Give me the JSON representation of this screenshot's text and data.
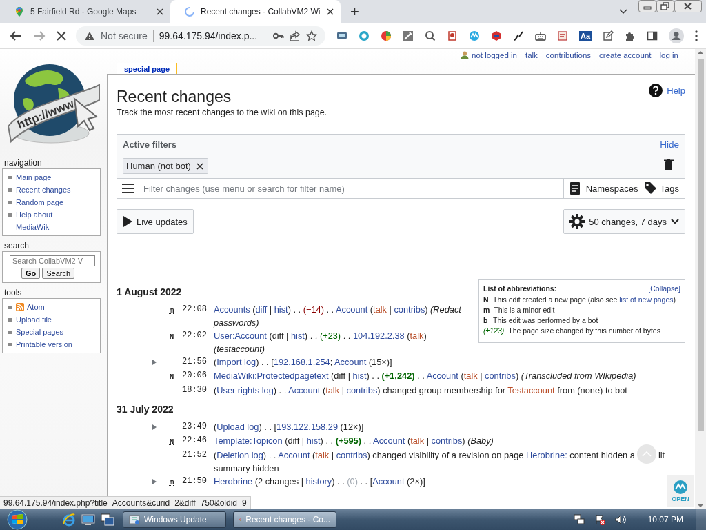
{
  "browser": {
    "tabs": [
      {
        "title": "5 Fairfield Rd - Google Maps",
        "kind": "maps",
        "selected": false
      },
      {
        "title": "Recent changes - CollabVM2 Wi",
        "kind": "loading",
        "selected": true
      }
    ],
    "new_tab": "+",
    "security": "Not secure",
    "url": "99.64.175.94/index.p...",
    "extension_label": "Aa",
    "status_url": "99.64.175.94/index.php?title=Accounts&curid=2&diff=750&oldid=9"
  },
  "personal": [
    "not logged in",
    "talk",
    "contributions",
    "create account",
    "log in"
  ],
  "logo_text": "http://www",
  "sidebar": [
    {
      "title": "navigation",
      "kind": "links",
      "items": [
        "Main page",
        "Recent changes",
        "Random page",
        "Help about MediaWiki"
      ]
    },
    {
      "title": "search",
      "kind": "search",
      "placeholder": "Search CollabVM2 V",
      "buttons": [
        "Go",
        "Search"
      ]
    },
    {
      "title": "tools",
      "kind": "links",
      "items": [
        {
          "label": "Atom",
          "kind": "feed"
        },
        {
          "label": "Upload file",
          "kind": "link"
        },
        {
          "label": "Special pages",
          "kind": "link"
        },
        {
          "label": "Printable version",
          "kind": "link"
        }
      ]
    }
  ],
  "content": {
    "tab": "special page",
    "title": "Recent changes",
    "help": "Help",
    "subtitle": "Track the most recent changes to the wiki on this page.",
    "filters": {
      "title": "Active filters",
      "hide": "Hide",
      "tags": [
        "Human (not bot)"
      ],
      "placeholder": "Filter changes (use menu or search for filter name)",
      "buttons": [
        "Namespaces",
        "Tags"
      ]
    },
    "live": "Live updates",
    "options": "50 changes, 7 days",
    "legend": {
      "title": "List of abbreviations:",
      "collapse": "[Collapse]",
      "rows": [
        {
          "key": "N",
          "kind": "flag",
          "parts": [
            {
              "kind": "text",
              "text": "This edit created a new page (also see "
            },
            {
              "kind": "link",
              "text": "list of new pages"
            },
            {
              "kind": "text",
              "text": ")"
            }
          ]
        },
        {
          "key": "m",
          "kind": "flag",
          "parts": [
            {
              "kind": "text",
              "text": "This is a minor edit"
            }
          ]
        },
        {
          "key": "b",
          "kind": "flag",
          "parts": [
            {
              "kind": "text",
              "text": "This edit was performed by a bot"
            }
          ]
        },
        {
          "key": "(±123)",
          "kind": "size",
          "parts": [
            {
              "kind": "text",
              "text": "The page size changed by this number of bytes"
            }
          ]
        }
      ]
    },
    "days": [
      {
        "date": "1 August 2022",
        "changes": [
          {
            "group": false,
            "flag": "m",
            "time": "22:08",
            "parts": [
              {
                "kind": "link",
                "text": "Accounts"
              },
              {
                "kind": "text",
                "text": " ("
              },
              {
                "kind": "link",
                "text": "diff"
              },
              {
                "kind": "text",
                "text": " | "
              },
              {
                "kind": "link",
                "text": "hist"
              },
              {
                "kind": "text",
                "text": ") . . "
              },
              {
                "kind": "neg",
                "text": "(−14)"
              },
              {
                "kind": "text",
                "text": " . . "
              },
              {
                "kind": "link",
                "text": "Account"
              },
              {
                "kind": "text",
                "text": " ("
              },
              {
                "kind": "red",
                "text": "talk"
              },
              {
                "kind": "text",
                "text": " | "
              },
              {
                "kind": "link",
                "text": "contribs"
              },
              {
                "kind": "text",
                "text": ") "
              },
              {
                "kind": "comment",
                "text": "(Redact passwords)"
              }
            ]
          },
          {
            "group": false,
            "flag": "N",
            "time": "22:02",
            "parts": [
              {
                "kind": "link",
                "text": "User:Account"
              },
              {
                "kind": "text",
                "text": " (diff | "
              },
              {
                "kind": "link",
                "text": "hist"
              },
              {
                "kind": "text",
                "text": ") . . "
              },
              {
                "kind": "pos",
                "text": "(+23)"
              },
              {
                "kind": "text",
                "text": " . . "
              },
              {
                "kind": "link",
                "text": "104.192.2.38"
              },
              {
                "kind": "text",
                "text": " ("
              },
              {
                "kind": "red",
                "text": "talk"
              },
              {
                "kind": "text",
                "text": ") "
              },
              {
                "kind": "comment",
                "text": "(testaccount)"
              }
            ]
          },
          {
            "group": true,
            "time": "21:56",
            "parts": [
              {
                "kind": "text",
                "text": "("
              },
              {
                "kind": "link",
                "text": "Import log"
              },
              {
                "kind": "text",
                "text": ") . . ["
              },
              {
                "kind": "link",
                "text": "192.168.1.254"
              },
              {
                "kind": "text",
                "text": "; "
              },
              {
                "kind": "link",
                "text": "Account"
              },
              {
                "kind": "text",
                "text": " (15×)]"
              }
            ]
          },
          {
            "group": false,
            "flag": "N",
            "time": "20:06",
            "parts": [
              {
                "kind": "link",
                "text": "MediaWiki:Protectedpagetext"
              },
              {
                "kind": "text",
                "text": " (diff | "
              },
              {
                "kind": "link",
                "text": "hist"
              },
              {
                "kind": "text",
                "text": ") . . "
              },
              {
                "kind": "posbig",
                "text": "(+1,242)"
              },
              {
                "kind": "text",
                "text": " . . "
              },
              {
                "kind": "link",
                "text": "Account"
              },
              {
                "kind": "text",
                "text": " ("
              },
              {
                "kind": "red",
                "text": "talk"
              },
              {
                "kind": "text",
                "text": " | "
              },
              {
                "kind": "link",
                "text": "contribs"
              },
              {
                "kind": "text",
                "text": ") "
              },
              {
                "kind": "comment",
                "text": "(Transcluded from WIkipedia)"
              }
            ]
          },
          {
            "group": false,
            "time": "18:30",
            "parts": [
              {
                "kind": "text",
                "text": "("
              },
              {
                "kind": "link",
                "text": "User rights log"
              },
              {
                "kind": "text",
                "text": ") . . "
              },
              {
                "kind": "link",
                "text": "Account"
              },
              {
                "kind": "text",
                "text": " ("
              },
              {
                "kind": "red",
                "text": "talk"
              },
              {
                "kind": "text",
                "text": " | "
              },
              {
                "kind": "link",
                "text": "contribs"
              },
              {
                "kind": "text",
                "text": ") changed group membership for "
              },
              {
                "kind": "red",
                "text": "Testaccount"
              },
              {
                "kind": "text",
                "text": " from (none) to bot"
              }
            ]
          }
        ]
      },
      {
        "date": "31 July 2022",
        "changes": [
          {
            "group": true,
            "time": "23:49",
            "parts": [
              {
                "kind": "text",
                "text": "("
              },
              {
                "kind": "link",
                "text": "Upload log"
              },
              {
                "kind": "text",
                "text": ") . . ["
              },
              {
                "kind": "link",
                "text": "193.122.158.29"
              },
              {
                "kind": "text",
                "text": " (12×)]"
              }
            ]
          },
          {
            "group": false,
            "flag": "N",
            "time": "22:46",
            "parts": [
              {
                "kind": "link",
                "text": "Template:Topicon"
              },
              {
                "kind": "text",
                "text": " (diff | "
              },
              {
                "kind": "link",
                "text": "hist"
              },
              {
                "kind": "text",
                "text": ") . . "
              },
              {
                "kind": "posbig",
                "text": "(+595)"
              },
              {
                "kind": "text",
                "text": " . . "
              },
              {
                "kind": "link",
                "text": "Account"
              },
              {
                "kind": "text",
                "text": " ("
              },
              {
                "kind": "red",
                "text": "talk"
              },
              {
                "kind": "text",
                "text": " | "
              },
              {
                "kind": "link",
                "text": "contribs"
              },
              {
                "kind": "text",
                "text": ") "
              },
              {
                "kind": "comment",
                "text": "(Baby)"
              }
            ]
          },
          {
            "group": false,
            "time": "21:52",
            "parts": [
              {
                "kind": "text",
                "text": "("
              },
              {
                "kind": "link",
                "text": "Deletion log"
              },
              {
                "kind": "text",
                "text": ") . . "
              },
              {
                "kind": "link",
                "text": "Account"
              },
              {
                "kind": "text",
                "text": " ("
              },
              {
                "kind": "red",
                "text": "talk"
              },
              {
                "kind": "text",
                "text": " | "
              },
              {
                "kind": "link",
                "text": "contribs"
              },
              {
                "kind": "text",
                "text": ") changed visibility of a revision on page "
              },
              {
                "kind": "link",
                "text": "Herobrine:"
              },
              {
                "kind": "text",
                "text": " content hidden a"
              },
              {
                "kind": "gap"
              },
              {
                "kind": "text",
                "text": "lit"
              },
              {
                "kind": "text",
                "text": "summary hidden"
              }
            ]
          },
          {
            "group": true,
            "flag": "m",
            "time": "21:50",
            "parts": [
              {
                "kind": "link",
                "text": "Herobrine"
              },
              {
                "kind": "text",
                "text": " (2 changes | "
              },
              {
                "kind": "link",
                "text": "history"
              },
              {
                "kind": "text",
                "text": ") . . "
              },
              {
                "kind": "zero",
                "text": "(0)"
              },
              {
                "kind": "text",
                "text": " . . ["
              },
              {
                "kind": "link",
                "text": "Account"
              },
              {
                "kind": "text",
                "text": " (2×)]"
              }
            ]
          }
        ]
      }
    ]
  },
  "open_badge": "OPEN",
  "taskbar": {
    "tasks": [
      {
        "title": "Windows Update",
        "kind": "update",
        "selected": false
      },
      {
        "title": "Recent changes - Co...",
        "kind": "chrome",
        "selected": true
      }
    ],
    "clock": "10:07 PM"
  }
}
